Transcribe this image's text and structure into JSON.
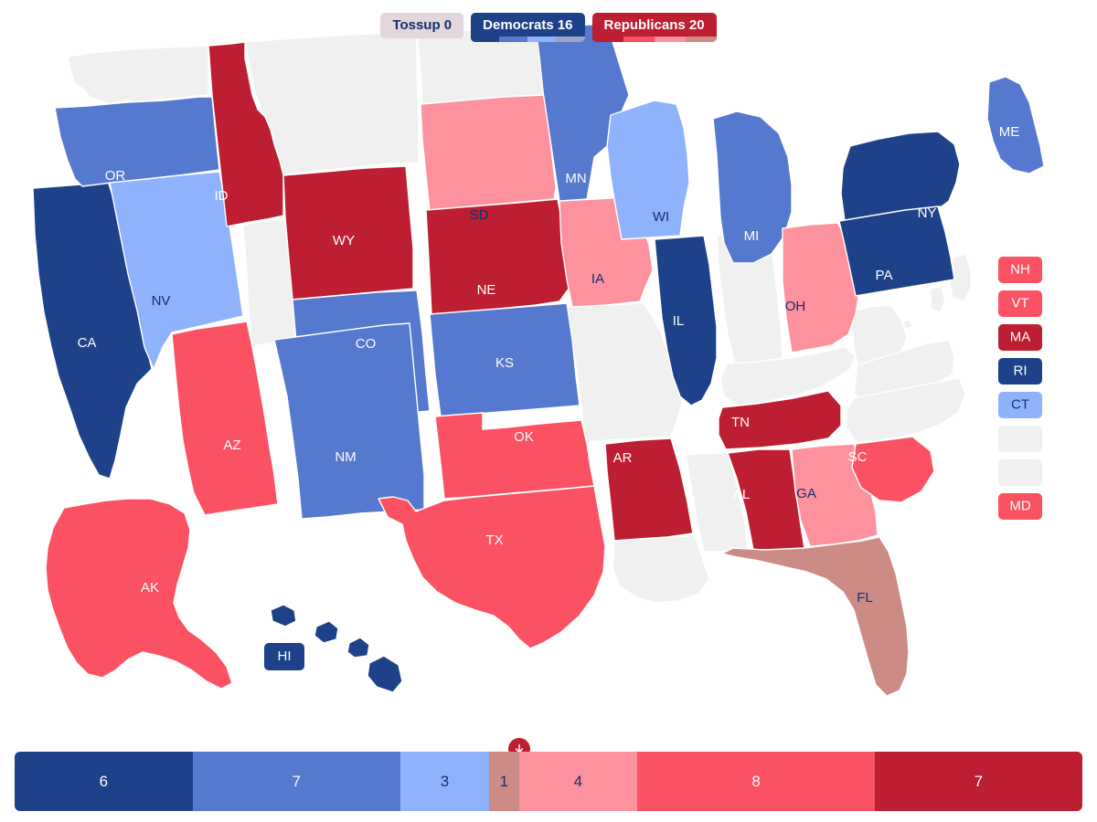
{
  "legend": {
    "tossup": {
      "label": "Tossup 0",
      "bg": "#e3d7dd",
      "text": "#14306b"
    },
    "democrats": {
      "label": "Democrats 16",
      "bg": "#1d4289",
      "text": "#ffffff",
      "strip": [
        "#1d4289",
        "#5579ce",
        "#8fb2fc",
        "#9aa5c4"
      ]
    },
    "republicans": {
      "label": "Republicans 20",
      "bg": "#bd1e31",
      "text": "#ffffff",
      "strip": [
        "#bd1e31",
        "#fb5263",
        "#fd919e",
        "#cc8c85"
      ]
    }
  },
  "palette": {
    "safe_d": "#1d4289",
    "likely_d": "#5579ce",
    "lean_d": "#8fb2fc",
    "tossup": "#cc8c85",
    "lean_r": "#fd919e",
    "likely_r": "#fb5263",
    "safe_r": "#bd1e31",
    "none": "#f0f0f0",
    "border": "#ffffff",
    "background": "#ffffff"
  },
  "map": {
    "states": [
      {
        "code": "CA",
        "rating": "safe_d",
        "label_fill": "light"
      },
      {
        "code": "OR",
        "rating": "likely_d",
        "label_fill": "light"
      },
      {
        "code": "NV",
        "rating": "lean_d",
        "label_fill": "dark"
      },
      {
        "code": "ID",
        "rating": "safe_r",
        "label_fill": "light"
      },
      {
        "code": "WY",
        "rating": "safe_r",
        "label_fill": "light"
      },
      {
        "code": "SD",
        "rating": "lean_r",
        "label_fill": "dark"
      },
      {
        "code": "NE",
        "rating": "safe_r",
        "label_fill": "light"
      },
      {
        "code": "IA",
        "rating": "lean_r",
        "label_fill": "dark"
      },
      {
        "code": "CO",
        "rating": "likely_d",
        "label_fill": "light"
      },
      {
        "code": "KS",
        "rating": "likely_d",
        "label_fill": "light"
      },
      {
        "code": "NM",
        "rating": "likely_d",
        "label_fill": "light"
      },
      {
        "code": "AZ",
        "rating": "likely_r",
        "label_fill": "light"
      },
      {
        "code": "TX",
        "rating": "likely_r",
        "label_fill": "light"
      },
      {
        "code": "OK",
        "rating": "likely_r",
        "label_fill": "light"
      },
      {
        "code": "MN",
        "rating": "likely_d",
        "label_fill": "light"
      },
      {
        "code": "WI",
        "rating": "lean_d",
        "label_fill": "dark"
      },
      {
        "code": "MI",
        "rating": "likely_d",
        "label_fill": "light"
      },
      {
        "code": "IL",
        "rating": "safe_d",
        "label_fill": "light"
      },
      {
        "code": "OH",
        "rating": "lean_r",
        "label_fill": "dark"
      },
      {
        "code": "AR",
        "rating": "safe_r",
        "label_fill": "light"
      },
      {
        "code": "TN",
        "rating": "safe_r",
        "label_fill": "light"
      },
      {
        "code": "AL",
        "rating": "safe_r",
        "label_fill": "light"
      },
      {
        "code": "GA",
        "rating": "lean_r",
        "label_fill": "dark"
      },
      {
        "code": "SC",
        "rating": "likely_r",
        "label_fill": "light"
      },
      {
        "code": "FL",
        "rating": "tossup",
        "label_fill": "dark"
      },
      {
        "code": "NY",
        "rating": "safe_d",
        "label_fill": "light"
      },
      {
        "code": "PA",
        "rating": "safe_d",
        "label_fill": "light"
      },
      {
        "code": "ME",
        "rating": "likely_d",
        "label_fill": "light"
      },
      {
        "code": "AK",
        "rating": "likely_r",
        "label_fill": "light"
      },
      {
        "code": "HI",
        "rating": "safe_d",
        "label_fill": "light"
      }
    ],
    "uncontested": [
      "WA",
      "MT",
      "ND",
      "UT",
      "MO",
      "IN",
      "KY",
      "WV",
      "VA",
      "NC",
      "MS",
      "LA",
      "DE",
      "NJ",
      "DC"
    ],
    "side_boxes": [
      {
        "code": "NH",
        "rating": "likely_r",
        "label_fill": "light"
      },
      {
        "code": "VT",
        "rating": "likely_r",
        "label_fill": "light"
      },
      {
        "code": "MA",
        "rating": "safe_r",
        "label_fill": "light"
      },
      {
        "code": "RI",
        "rating": "safe_d",
        "label_fill": "light"
      },
      {
        "code": "CT",
        "rating": "lean_d",
        "label_fill": "dark"
      },
      {
        "code": "",
        "rating": "none",
        "label_fill": "dark"
      },
      {
        "code": "",
        "rating": "none",
        "label_fill": "dark"
      },
      {
        "code": "MD",
        "rating": "likely_r",
        "label_fill": "light"
      }
    ]
  },
  "seatbar": {
    "segments": [
      {
        "value": 6,
        "label": "6",
        "color": "#1d4289",
        "text_tone": "on-dark"
      },
      {
        "value": 7,
        "label": "7",
        "color": "#5579ce",
        "text_tone": "on-dark"
      },
      {
        "value": 3,
        "label": "3",
        "color": "#8fb2fc",
        "text_tone": "on-light"
      },
      {
        "value": 1,
        "label": "1",
        "color": "#cc8c85",
        "text_tone": "on-light"
      },
      {
        "value": 4,
        "label": "4",
        "color": "#fd919e",
        "text_tone": "on-light"
      },
      {
        "value": 8,
        "label": "8",
        "color": "#fb5263",
        "text_tone": "on-dark"
      },
      {
        "value": 7,
        "label": "7",
        "color": "#bd1e31",
        "text_tone": "on-dark"
      }
    ],
    "total": 36,
    "marker": {
      "position_value": 17,
      "color": "#bd1e31",
      "icon": "arrow-down-icon"
    }
  }
}
